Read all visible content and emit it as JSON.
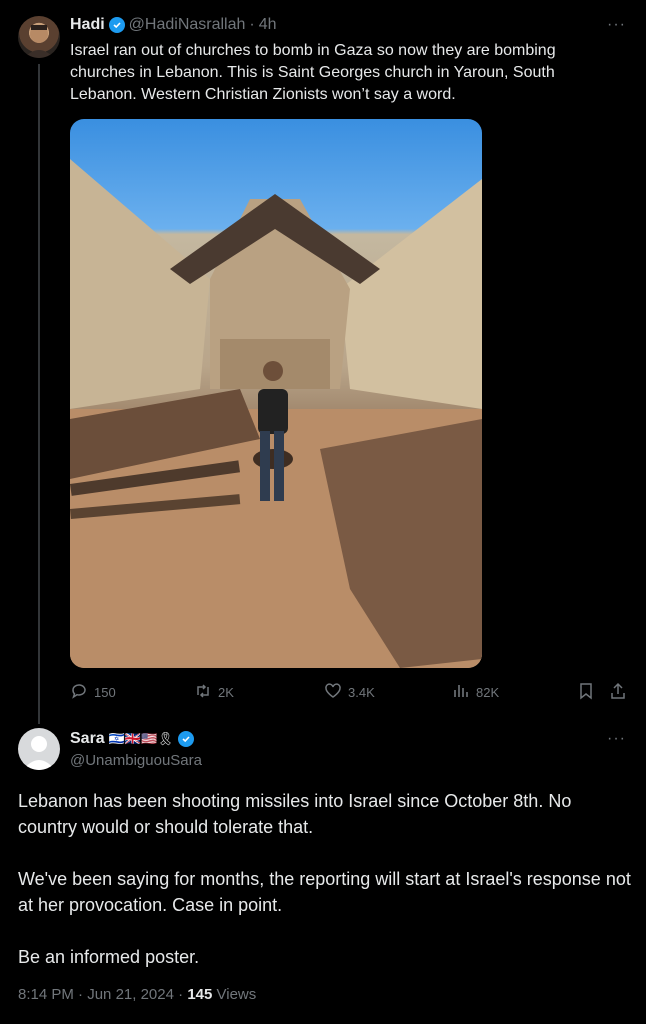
{
  "tweet1": {
    "name": "Hadi",
    "handle": "@HadiNasrallah",
    "time": "4h",
    "text": "Israel ran out of churches to bomb in Gaza so now they are bombing churches in Lebanon. This is Saint Georges church in Yaroun, South Lebanon. Western Christian Zionists won’t say a word.",
    "more_icon": "more-horizontal-icon",
    "stats": {
      "replies": "150",
      "reposts": "2K",
      "likes": "3.4K",
      "views": "82K"
    }
  },
  "tweet2": {
    "name": "Sara",
    "flags": "🇮🇱🇬🇧🇺🇸🎗",
    "handle": "@UnambiguouSara",
    "paragraphs": [
      "Lebanon has been shooting missiles into Israel since October 8th. No country would or should tolerate that.",
      "We've been saying for months, the reporting will start at Israel's response not at her provocation. Case in point.",
      "Be an informed poster."
    ],
    "time": "8:14 PM",
    "date": "Jun 21, 2024",
    "views_count": "145",
    "views_label": "Views"
  },
  "colors": {
    "background": "#000000",
    "text": "#e7e9ea",
    "muted": "#71767b",
    "verified": "#1d9bf0",
    "thread_line": "#333639"
  }
}
